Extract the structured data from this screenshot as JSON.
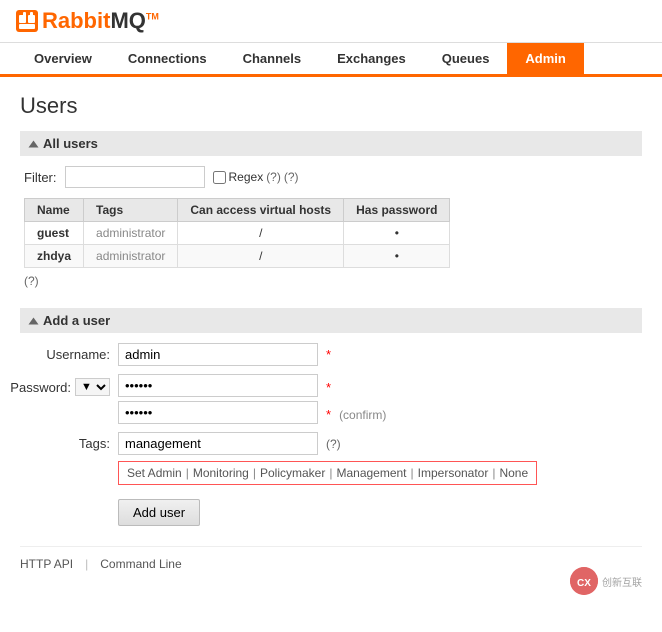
{
  "header": {
    "logo_text": "RabbitMQ",
    "logo_tm": "TM"
  },
  "nav": {
    "items": [
      {
        "label": "Overview",
        "active": false
      },
      {
        "label": "Connections",
        "active": false
      },
      {
        "label": "Channels",
        "active": false
      },
      {
        "label": "Exchanges",
        "active": false
      },
      {
        "label": "Queues",
        "active": false
      },
      {
        "label": "Admin",
        "active": true
      }
    ]
  },
  "page": {
    "title": "Users"
  },
  "all_users_section": {
    "header": "All users",
    "filter_label": "Filter:",
    "filter_placeholder": "",
    "regex_label": "Regex",
    "help1": "(?)",
    "help2": "(?)",
    "table": {
      "columns": [
        "Name",
        "Tags",
        "Can access virtual hosts",
        "Has password"
      ],
      "rows": [
        {
          "name": "guest",
          "tags": "administrator",
          "vhosts": "/",
          "has_password": "•"
        },
        {
          "name": "zhdya",
          "tags": "administrator",
          "vhosts": "/",
          "has_password": "•"
        }
      ]
    },
    "help_text": "(?)"
  },
  "add_user_section": {
    "header": "Add a user",
    "username_label": "Username:",
    "username_value": "admin",
    "password_label": "Password:",
    "password_value": "••••••",
    "password_confirm_value": "••••••",
    "confirm_text": "(confirm)",
    "required": "*",
    "tags_label": "Tags:",
    "tags_value": "management",
    "tags_help": "(?)",
    "tag_hints": [
      "Set  Admin",
      "Monitoring",
      "Policymaker",
      "Management",
      "Impersonator",
      "None"
    ],
    "add_button": "Add user"
  },
  "footer": {
    "http_api": "HTTP API",
    "command_line": "Command Line",
    "separator": "|"
  },
  "watermark": {
    "text": "创新互联"
  }
}
